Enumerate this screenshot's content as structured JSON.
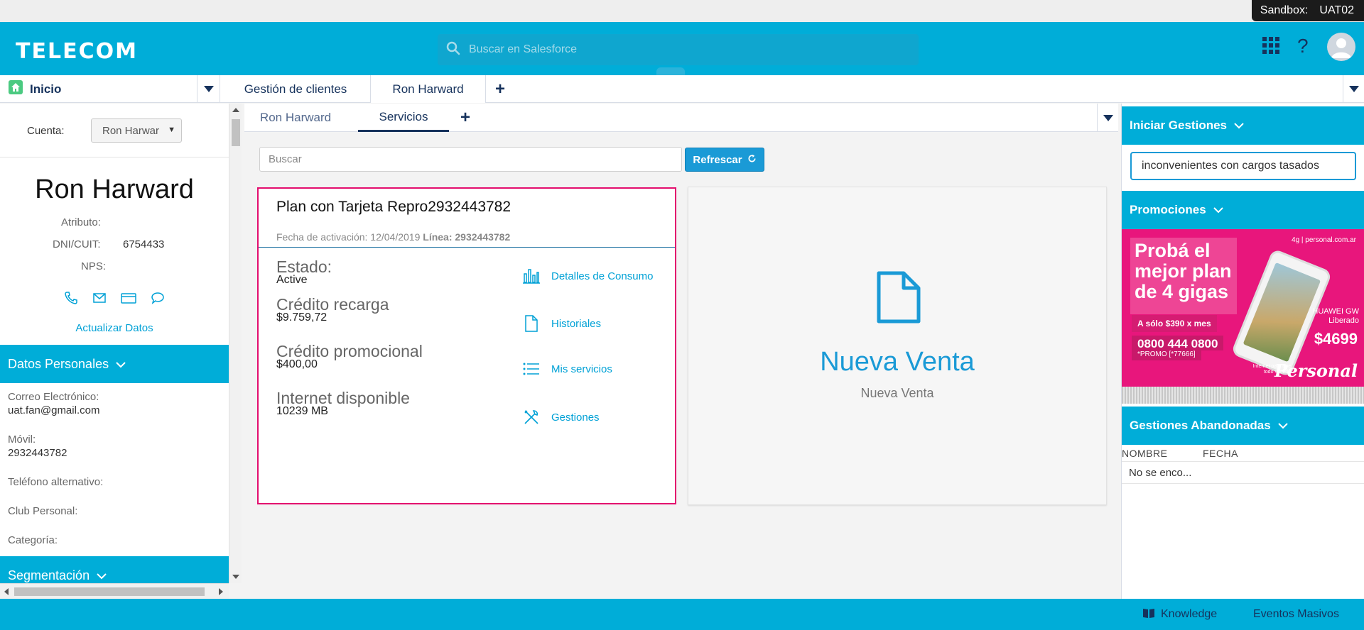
{
  "sandbox": {
    "label": "Sandbox:",
    "env": "UAT02"
  },
  "header": {
    "logo": "TELECOM",
    "search_placeholder": "Buscar en Salesforce"
  },
  "tabs": {
    "home": "Inicio",
    "items": [
      {
        "label": "Gestión de clientes"
      },
      {
        "label": "Ron Harward"
      }
    ],
    "plus": "+"
  },
  "left": {
    "cuenta_label": "Cuenta:",
    "cuenta_value": "Ron Harwar",
    "name": "Ron Harward",
    "attributes": {
      "atributo_label": "Atributo:",
      "dni_label": "DNI/CUIT:",
      "dni_value": "6754433",
      "nps_label": "NPS:"
    },
    "update_link": "Actualizar Datos",
    "datos_personales": "Datos Personales",
    "fields": {
      "email_label": "Correo Electrónico:",
      "email_value": "uat.fan@gmail.com",
      "movil_label": "Móvil:",
      "movil_value": "2932443782",
      "alt_label": "Teléfono alternativo:",
      "club_label": "Club Personal:",
      "categoria_label": "Categoría:"
    },
    "segmentacion": "Segmentación"
  },
  "subtabs": {
    "items": [
      {
        "label": "Ron Harward"
      },
      {
        "label": "Servicios"
      }
    ],
    "plus": "+"
  },
  "main": {
    "search_placeholder": "Buscar",
    "refresh_label": "Refrescar",
    "plan": {
      "title": "Plan con Tarjeta Repro2932443782",
      "activation_label": "Fecha de activación:",
      "activation_date": "12/04/2019",
      "line_label": "Línea:",
      "line_value": "2932443782",
      "stats": [
        {
          "label": "Estado:",
          "value": "Active"
        },
        {
          "label": "Crédito recarga",
          "value": "$9.759,72"
        },
        {
          "label": "Crédito promocional",
          "value": "$400,00"
        },
        {
          "label": "Internet disponible",
          "value": "10239 MB"
        }
      ],
      "actions": [
        {
          "label": "Detalles de Consumo",
          "icon": "bar-chart-icon"
        },
        {
          "label": "Historiales",
          "icon": "document-icon"
        },
        {
          "label": "Mis servicios",
          "icon": "list-icon"
        },
        {
          "label": "Gestiones",
          "icon": "tools-icon"
        }
      ]
    },
    "venta": {
      "title": "Nueva Venta",
      "subtitle": "Nueva Venta"
    }
  },
  "right": {
    "iniciar": "Iniciar Gestiones",
    "gestion_value": "inconvenientes con cargos tasados",
    "promociones": "Promociones",
    "promo": {
      "headline": "Probá el mejor plan de 4 gigas",
      "price_a": "A sólo $390 x mes",
      "phone": "0800 444 0800",
      "code": "*PROMO [*77666]",
      "brand_top": "4g | personal.com.ar",
      "device": "HUAWEI GW",
      "liberado": "Liberado",
      "price_b": "$4699",
      "tagline": "Internet para que todo suceda",
      "brand": "Personal"
    },
    "abandonadas": "Gestiones Abandonadas",
    "table": {
      "columns": [
        "NOMBRE",
        "FECHA"
      ],
      "empty": "No se enco..."
    }
  },
  "footer": {
    "knowledge": "Knowledge",
    "eventos": "Eventos Masivos"
  },
  "colors": {
    "brand": "#00add8",
    "accent": "#1a9ad6",
    "card_border": "#e30e6e"
  }
}
